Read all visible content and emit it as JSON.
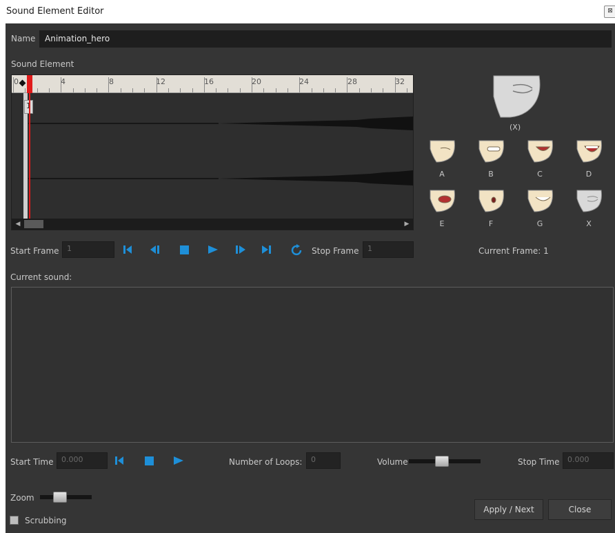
{
  "window": {
    "title": "Sound Element Editor",
    "close_glyph": "⊠"
  },
  "name_field": {
    "label": "Name",
    "value": "Animation_hero"
  },
  "sound_element": {
    "label": "Sound Element",
    "ruler_labels": [
      "0",
      "4",
      "8",
      "12",
      "16",
      "20",
      "24",
      "28",
      "32"
    ],
    "current_frame_marker": "1"
  },
  "lip_sync": {
    "preview_label": "(X)",
    "mouths": [
      {
        "label": "A",
        "icon": "mouth-A-icon"
      },
      {
        "label": "B",
        "icon": "mouth-B-icon"
      },
      {
        "label": "C",
        "icon": "mouth-C-icon"
      },
      {
        "label": "D",
        "icon": "mouth-D-icon"
      },
      {
        "label": "E",
        "icon": "mouth-E-icon"
      },
      {
        "label": "F",
        "icon": "mouth-F-icon"
      },
      {
        "label": "G",
        "icon": "mouth-G-icon"
      },
      {
        "label": "X",
        "icon": "mouth-X-icon"
      }
    ],
    "current_frame_text": "Current Frame: 1"
  },
  "frame_transport": {
    "start_frame_label": "Start Frame",
    "start_frame_value": "1",
    "stop_frame_label": "Stop Frame",
    "stop_frame_value": "1",
    "buttons": [
      "first-frame-icon",
      "previous-frame-icon",
      "stop-icon",
      "play-icon",
      "next-frame-icon",
      "last-frame-icon",
      "loop-icon"
    ]
  },
  "current_sound": {
    "label": "Current sound:"
  },
  "time_transport": {
    "start_time_label": "Start Time",
    "start_time_value": "0.000",
    "loops_label": "Number of Loops:",
    "loops_value": "0",
    "volume_label": "Volume",
    "volume_level": 0.45,
    "stop_time_label": "Stop Time",
    "stop_time_value": "0.000"
  },
  "zoom": {
    "label": "Zoom",
    "level": 0.35
  },
  "scrubbing": {
    "label": "Scrubbing",
    "checked": false
  },
  "buttons": {
    "apply_next": "Apply / Next",
    "close": "Close"
  },
  "colors": {
    "accent": "#1e8fd8",
    "playhead": "#e01b1b",
    "panel": "#353535"
  }
}
